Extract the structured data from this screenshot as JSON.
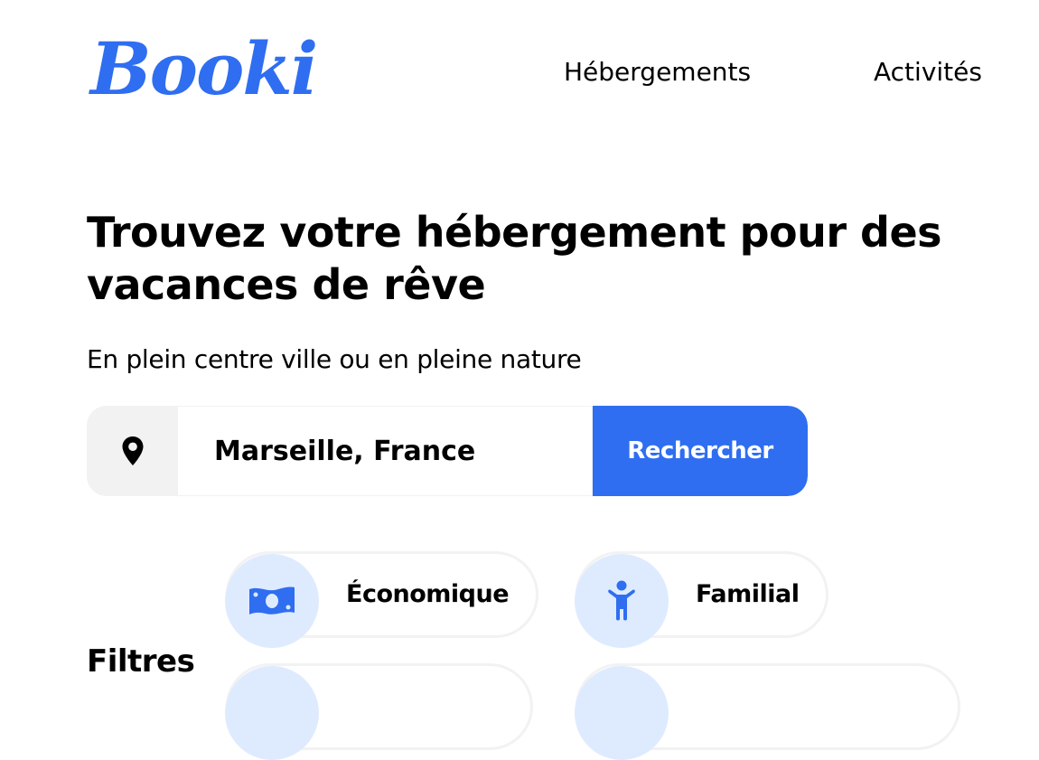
{
  "header": {
    "logo_text": "Booki",
    "nav": [
      {
        "label": "Hébergements"
      },
      {
        "label": "Activités"
      }
    ]
  },
  "hero": {
    "title": "Trouvez votre hébergement pour des vacances de rêve",
    "subtitle": "En plein centre ville ou en pleine nature"
  },
  "search": {
    "icon": "map-pin-icon",
    "value": "Marseille, France",
    "button_label": "Rechercher"
  },
  "filters": {
    "label": "Filtres",
    "items": [
      {
        "label": "Économique",
        "icon": "money-bill-icon"
      },
      {
        "label": "Familial",
        "icon": "child-icon"
      },
      {
        "label": "",
        "icon": ""
      },
      {
        "label": "",
        "icon": ""
      }
    ]
  },
  "colors": {
    "brand": "#2f6ef0",
    "icon_bg": "#deebff",
    "muted_bg": "#f2f2f2",
    "text": "#000000"
  }
}
